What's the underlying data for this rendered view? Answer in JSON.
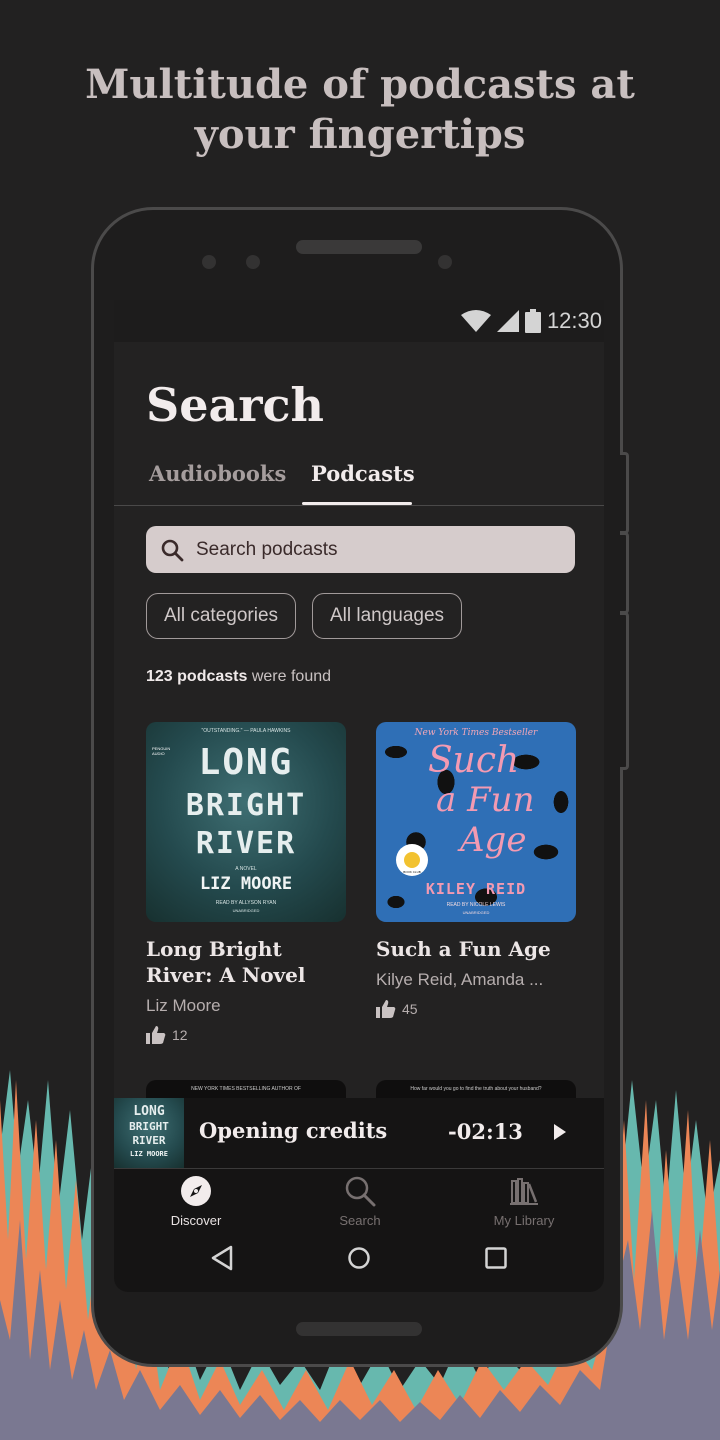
{
  "headline": {
    "line1": "Multitude of podcasts at",
    "line2": "your fingertips"
  },
  "status_bar": {
    "time": "12:30",
    "icons": [
      "wifi-icon",
      "signal-icon",
      "battery-icon"
    ]
  },
  "page": {
    "title": "Search"
  },
  "tabs": [
    {
      "label": "Audiobooks",
      "active": false
    },
    {
      "label": "Podcasts",
      "active": true
    }
  ],
  "search": {
    "placeholder": "Search podcasts",
    "value": ""
  },
  "filters": {
    "categories": "All categories",
    "languages": "All languages"
  },
  "results": {
    "count_label": "123 podcasts",
    "suffix": "were found"
  },
  "items": [
    {
      "title": "Long Bright River: A Novel",
      "author": "Liz Moore",
      "likes": "12",
      "cover": {
        "top": "\"OUTSTANDING.\" — PAULA HAWKINS",
        "brand": "PENGUIN AUDIO",
        "line1": "LONG",
        "line2": "BRIGHT",
        "line3": "RIVER",
        "novel": "A NOVEL",
        "author": "LIZ MOORE",
        "reader": "READ BY ALLYSON RYAN",
        "edition": "UNABRIDGED"
      }
    },
    {
      "title": "Such a Fun Age",
      "author": "Kilye Reid, Amanda ...",
      "likes": "45",
      "cover": {
        "top": "New York Times Bestseller",
        "line1": "Such",
        "line2": "a Fun",
        "line3": "Age",
        "author": "KILEY REID",
        "reader": "READ BY NICOLE LEWIS",
        "edition": "UNABRIDGED",
        "badge": "BOOK CLUB"
      }
    }
  ],
  "peek_items": [
    {
      "text": "NEW YORK TIMES BESTSELLING AUTHOR OF"
    },
    {
      "text": "How far would you go to find the truth about your husband?"
    }
  ],
  "player": {
    "title": "Opening credits",
    "time": "-02:13",
    "thumb": {
      "line1": "LONG",
      "line2": "BRIGHT",
      "line3": "RIVER",
      "author": "LIZ MOORE"
    }
  },
  "bottom_nav": [
    {
      "label": "Discover",
      "icon": "compass-icon",
      "active": true
    },
    {
      "label": "Search",
      "icon": "search-icon",
      "active": false
    },
    {
      "label": "My Library",
      "icon": "library-icon",
      "active": false
    }
  ],
  "colors": {
    "background": "#222121",
    "accent_orange": "#ec8656",
    "accent_teal": "#67b8ae",
    "accent_purple": "#7a7891"
  }
}
